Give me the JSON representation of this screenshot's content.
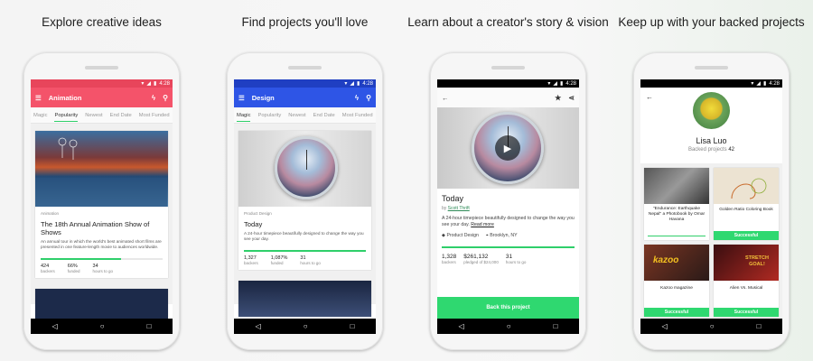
{
  "panels": [
    {
      "caption": "Explore creative ideas",
      "status_time": "4:28",
      "appbar_title": "Animation",
      "tabs": [
        "Magic",
        "Popularity",
        "Newest",
        "End Date",
        "Most Funded"
      ],
      "active_tab": "Popularity",
      "card": {
        "category": "Animation",
        "title": "The 18th Annual Animation Show of Shows",
        "description": "An annual tour in which the world's best animated short films are presented in one feature-length movie to audiences worldwide.",
        "funded_fraction": 0.66,
        "stats": [
          {
            "value": "424",
            "label": "backers"
          },
          {
            "value": "66%",
            "label": "funded"
          },
          {
            "value": "34",
            "label": "hours to go"
          }
        ]
      }
    },
    {
      "caption": "Find projects you'll love",
      "status_time": "4:28",
      "appbar_title": "Design",
      "tabs": [
        "Magic",
        "Popularity",
        "Newest",
        "End Date",
        "Most Funded"
      ],
      "active_tab": "Magic",
      "card": {
        "category": "Product Design",
        "title": "Today",
        "description": "A 24-hour timepiece beautifully designed to change the way you see your day.",
        "funded_fraction": 1.0,
        "stats": [
          {
            "value": "1,327",
            "label": "backers"
          },
          {
            "value": "1,087%",
            "label": "funded"
          },
          {
            "value": "31",
            "label": "hours to go"
          }
        ]
      }
    },
    {
      "caption": "Learn about a creator's story & vision",
      "status_time": "4:28",
      "project": {
        "title": "Today",
        "by": "by ",
        "creator": "Scott Thrift",
        "description": "A 24-hour timepiece beautifully designed to change the way you see your day.",
        "read_more": "Read more",
        "category": "Product Design",
        "location": "Brooklyn, NY",
        "stats": [
          {
            "value": "1,328",
            "label": "backers"
          },
          {
            "value": "$261,132",
            "label": "pledged of $24,000"
          },
          {
            "value": "31",
            "label": "hours to go"
          }
        ],
        "back_button": "Back this project"
      }
    },
    {
      "caption": "Keep up with your backed projects",
      "status_time": "4:28",
      "profile": {
        "name": "Lisa Luo",
        "backed_label": "Backed projects",
        "backed_count": "42"
      },
      "backed": [
        {
          "title": "\"Endurance: Earthquake Nepal\" a Photobook by Omar Havana",
          "status": ""
        },
        {
          "title": "Golden Ratio Coloring Book",
          "status": "Successful"
        },
        {
          "title": "Kazoo magazine",
          "status": "Successful",
          "image_text": "kazoo"
        },
        {
          "title": "Alien Vs. Musical",
          "status": "Successful",
          "image_text": "STRETCH GOAL!"
        }
      ]
    }
  ],
  "colors": {
    "animation_bar": "#f4536a",
    "animation_status": "#e8455b",
    "design_bar": "#2e55e6",
    "design_status": "#1f3fc2",
    "green": "#2fd870"
  },
  "nav": {
    "back": "◁",
    "home": "○",
    "recent": "□"
  }
}
